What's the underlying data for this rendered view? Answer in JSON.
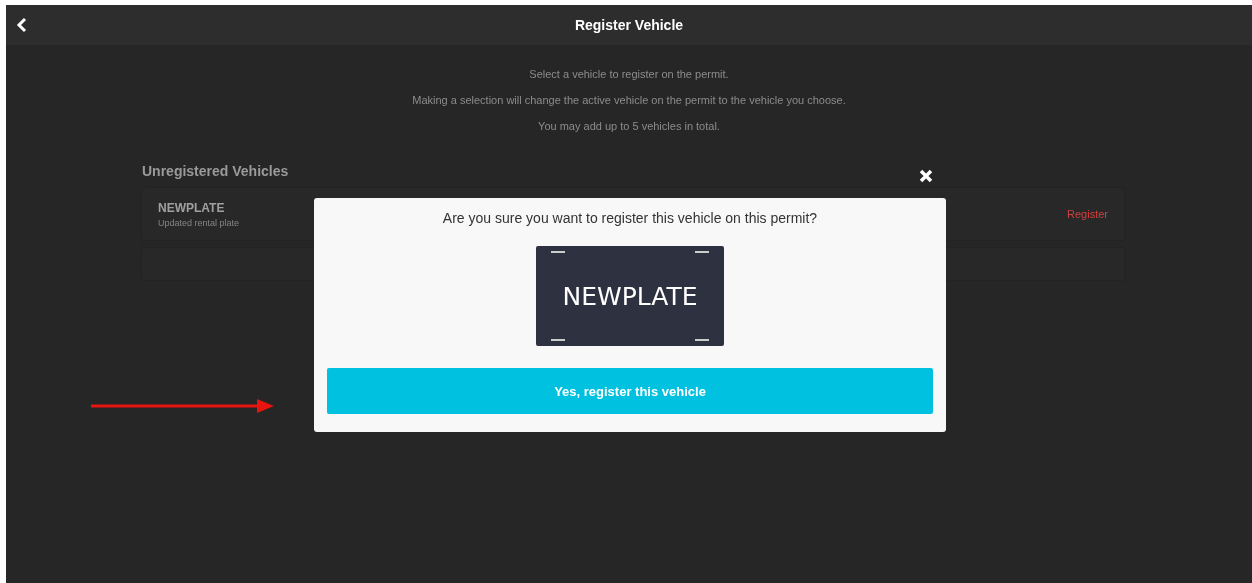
{
  "header": {
    "title": "Register Vehicle"
  },
  "intro": [
    "Select a vehicle to register on the permit.",
    "Making a selection will change the active vehicle on the permit to the vehicle you choose.",
    "You may add up to 5 vehicles in total."
  ],
  "unregistered": {
    "title": "Unregistered Vehicles",
    "vehicles": [
      {
        "plate": "NEWPLATE",
        "note": "Updated rental plate",
        "action": "Register"
      }
    ]
  },
  "dialog": {
    "question": "Are you sure you want to register this vehicle on this permit?",
    "plate": "NEWPLATE",
    "confirm": "Yes, register this vehicle"
  }
}
